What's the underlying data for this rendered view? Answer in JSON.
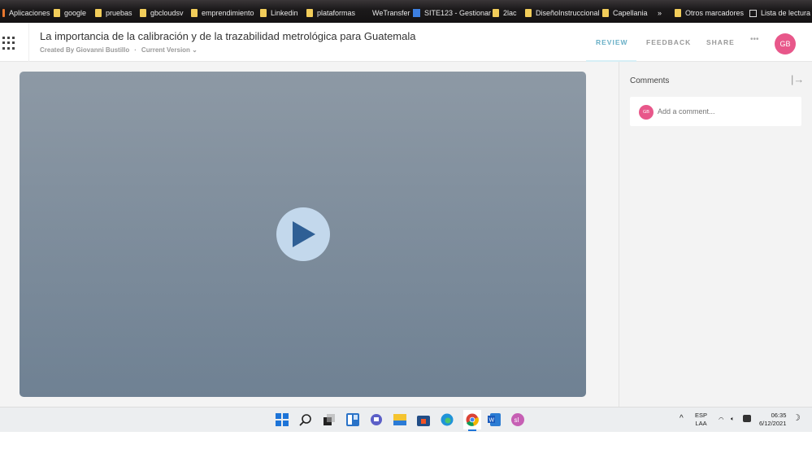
{
  "bookmarks": {
    "apps": "Aplicaciones",
    "items": [
      "google",
      "pruebas",
      "gbcloudsv",
      "emprendimiento",
      "Linkedin",
      "plataformas",
      "WeTransfer",
      "SITE123 - Gestionar",
      "2lac",
      "DiseñoInstruccional",
      "Capellania"
    ],
    "overflow": "»",
    "other": "Otros marcadores",
    "reading": "Lista de lectura"
  },
  "header": {
    "title": "La importancia de la calibración y de la trazabilidad metrológica para Guatemala",
    "created_by": "Created By Giovanni Bustillo",
    "dot": "·",
    "version": "Current Version ⌄",
    "tabs": [
      "REVIEW",
      "FEEDBACK",
      "SHARE"
    ],
    "more": "•••",
    "avatar": "GB"
  },
  "comments": {
    "title": "Comments",
    "collapse": "|→",
    "avatar": "GB",
    "placeholder": "Add a comment..."
  },
  "taskbar": {
    "lang": "ESP",
    "layout": "LAA",
    "time": "06:35",
    "date": "6/12/2021",
    "chevron": "^"
  }
}
